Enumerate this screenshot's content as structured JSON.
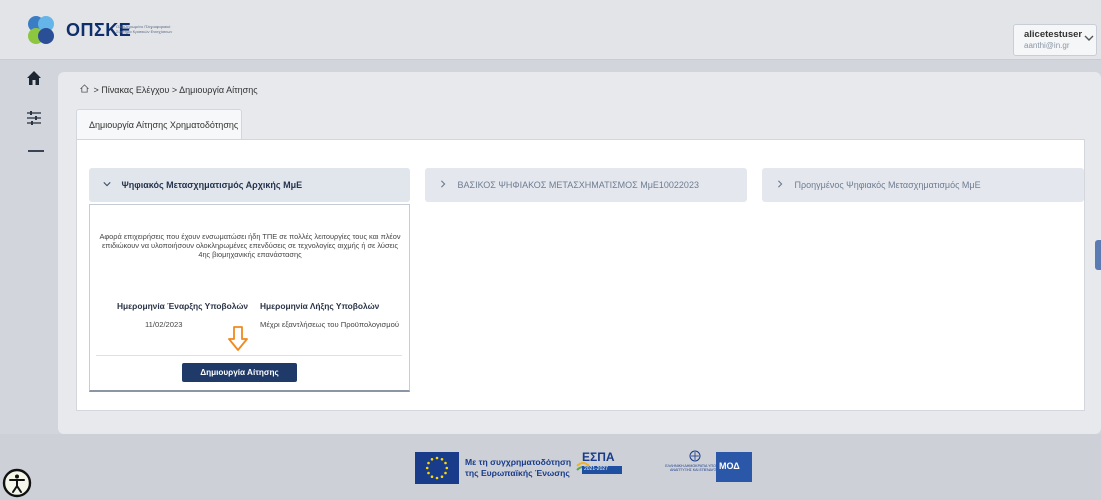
{
  "header": {
    "logo_text": "ΟΠΣΚΕ",
    "logo_tagline": "Ολοκληρωμένο Πληροφοριακό Σύστημα Κρατικών Ενισχύσεων",
    "user": {
      "name": "alicetestuser",
      "email": "aanthi@in.gr"
    }
  },
  "sidebar": {
    "items": [
      "home-icon",
      "sliders-icon",
      "minus-icon"
    ]
  },
  "breadcrumb": {
    "items": [
      "Πίνακας Ελέγχου",
      "Δημιουργία Αίτησης"
    ],
    "separator": ">"
  },
  "tab": {
    "label": "Δημιουργία Αίτησης Χρηματοδότησης"
  },
  "accordions": [
    {
      "title": "Ψηφιακός Μετασχηματισμός Αρχικής ΜμΕ",
      "expanded": true
    },
    {
      "title": "ΒΑΣΙΚΟΣ ΨΗΦΙΑΚΟΣ ΜΕΤΑΣΧΗΜΑΤΙΣΜΟΣ ΜμΕ10022023",
      "expanded": false
    },
    {
      "title": "Προηγμένος Ψηφιακός Μετασχηματισμός ΜμΕ",
      "expanded": false
    }
  ],
  "card": {
    "description": "Αφορά επιχειρήσεις που έχουν ενσωματώσει ήδη ΤΠΕ σε πολλές λειτουργίες τους και πλέον επιδιώκουν να υλοποιήσουν ολοκληρωμένες επενδύσεις σε τεχνολογίες αιχμής ή σε λύσεις 4ης βιομηχανικής επανάστασης",
    "start_label": "Ημερομηνία Έναρξης Υποβολών",
    "start_value": "11/02/2023",
    "end_label": "Ημερομηνία Λήξης Υποβολών",
    "end_value": "Μέχρι εξαντλήσεως του Προϋπολογισμού",
    "button_label": "Δημιουργία Αίτησης"
  },
  "footer": {
    "eu_line1": "Με τη συγχρηματοδότηση",
    "eu_line2": "της Ευρωπαϊκής Ένωσης",
    "espa_word": "ΕΣΠΑ",
    "espa_years": "2021-2027",
    "gov_text": "ΕΛΛΗΝΙΚΗ ΔΗΜΟΚΡΑΤΙΑ ΥΠΟΥΡΓΕΙΟ ΑΝΑΠΤΥΞΗΣ ΚΑΙ ΕΠΕΝΔΥΣΕΩΝ",
    "mod_text": "ΜΟΔ"
  },
  "colors": {
    "primary_button": "#1f3a68",
    "arrow": "#f08a1c",
    "eu_blue": "#183b8a"
  }
}
